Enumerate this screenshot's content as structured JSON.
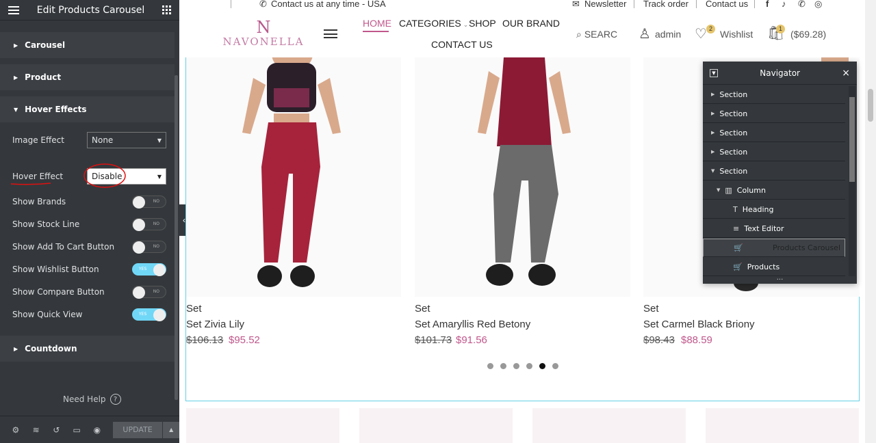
{
  "editor": {
    "title": "Edit Products Carousel",
    "sections": [
      "Carousel",
      "Product",
      "Hover Effects",
      "Countdown"
    ],
    "controls": {
      "image_effect": {
        "label": "Image Effect",
        "value": "None"
      },
      "hover_effect": {
        "label": "Hover Effect",
        "value": "Disable"
      },
      "toggles": [
        {
          "label": "Show Brands",
          "state": "NO"
        },
        {
          "label": "Show Stock Line",
          "state": "NO"
        },
        {
          "label": "Show Add To Cart Button",
          "state": "NO"
        },
        {
          "label": "Show Wishlist Button",
          "state": "YES"
        },
        {
          "label": "Show Compare Button",
          "state": "NO"
        },
        {
          "label": "Show Quick View",
          "state": "YES"
        }
      ]
    },
    "help": "Need Help",
    "help_icon": "?",
    "update": "UPDATE"
  },
  "site": {
    "topbar": {
      "contact": "Contact us at any time - USA",
      "newsletter": "Newsletter",
      "track": "Track order",
      "contact_link": "Contact us",
      "social": [
        "f",
        "♪",
        "✆",
        "◎"
      ]
    },
    "logo": {
      "mono": "N",
      "name": "NAVONELLA"
    },
    "menu": [
      "HOME",
      "CATEGORIES",
      "SHOP",
      "OUR BRAND",
      "CONTACT US"
    ],
    "search": "SEARC",
    "user": "admin",
    "wishlist": "Wishlist",
    "wishlist_count": "2",
    "cart_count": "1",
    "cart_total": "($69.28)",
    "products": [
      {
        "category": "Set",
        "name": "Set Zivia Lily",
        "old": "$106.13",
        "price": "$95.52"
      },
      {
        "category": "Set",
        "name": "Set Amaryllis Red Betony",
        "old": "$101.73",
        "price": "$91.56"
      },
      {
        "category": "Set",
        "name": "Set Carmel Black Briony",
        "old": "$98.43",
        "price": "$88.59"
      }
    ]
  },
  "navigator": {
    "title": "Navigator",
    "items": [
      {
        "label": "Section"
      },
      {
        "label": "Section"
      },
      {
        "label": "Section"
      },
      {
        "label": "Section"
      },
      {
        "label": "Section"
      },
      {
        "label": "Column"
      },
      {
        "label": "Heading"
      },
      {
        "label": "Text Editor"
      },
      {
        "label": "Products Carousel"
      },
      {
        "label": "Products"
      }
    ],
    "more": "...",
    "close": "×"
  },
  "colors": {
    "accent": "#c0578b",
    "panel": "#34383c",
    "toggle_on": "#71d7f7",
    "highlight": "#65d0e4"
  }
}
